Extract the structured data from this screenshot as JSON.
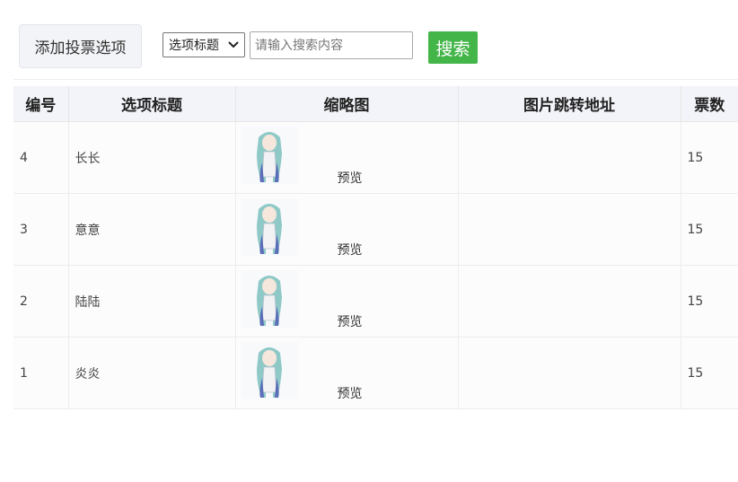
{
  "toolbar": {
    "add_button_label": "添加投票选项",
    "select_value": "选项标题",
    "search_placeholder": "请输入搜索内容",
    "search_button_label": "搜索"
  },
  "colors": {
    "accent_green": "#44b549",
    "header_bg": "#f3f4f9"
  },
  "table": {
    "columns": [
      "编号",
      "选项标题",
      "缩略图",
      "图片跳转地址",
      "票数"
    ],
    "rows": [
      {
        "id": "4",
        "title": "长长",
        "preview": "预览",
        "link": "",
        "votes": "15"
      },
      {
        "id": "3",
        "title": "意意",
        "preview": "预览",
        "link": "",
        "votes": "15"
      },
      {
        "id": "2",
        "title": "陆陆",
        "preview": "预览",
        "link": "",
        "votes": "15"
      },
      {
        "id": "1",
        "title": "炎炎",
        "preview": "预览",
        "link": "",
        "votes": "15"
      }
    ]
  },
  "icons": {
    "select_arrow": "chevron-down-icon",
    "thumbnail": "character-image-icon"
  }
}
